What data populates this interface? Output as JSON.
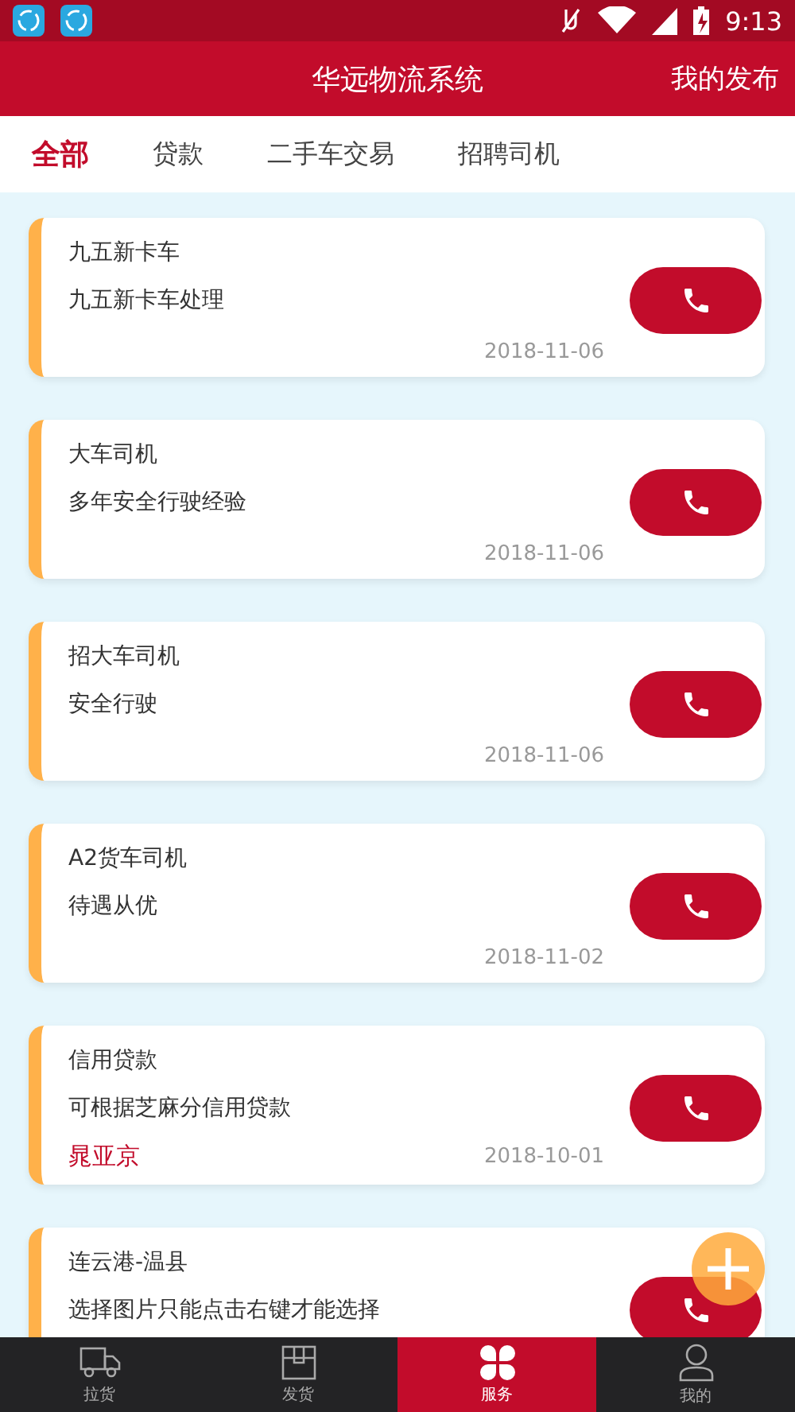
{
  "status_bar": {
    "time": "9:13"
  },
  "header": {
    "title": "华远物流系统",
    "action": "我的发布"
  },
  "tabs": [
    {
      "label": "全部",
      "selected": true
    },
    {
      "label": "贷款",
      "selected": false
    },
    {
      "label": "二手车交易",
      "selected": false
    },
    {
      "label": "招聘司机",
      "selected": false
    }
  ],
  "posts": [
    {
      "title": "九五新卡车",
      "description": "九五新卡车处理",
      "date": "2018-11-06"
    },
    {
      "title": "大车司机",
      "description": "多年安全行驶经验",
      "date": "2018-11-06"
    },
    {
      "title": "招大车司机",
      "description": "安全行驶",
      "date": "2018-11-06"
    },
    {
      "title": "A2货车司机",
      "description": "待遇从优",
      "date": "2018-11-02"
    },
    {
      "title": "信用贷款",
      "description": "可根据芝麻分信用贷款",
      "contact": "晁亚京",
      "date": "2018-10-01"
    },
    {
      "title": "连云港-温县",
      "description": "选择图片只能点击右键才能选择"
    }
  ],
  "bottom_nav": [
    {
      "label": "拉货",
      "kind": "truck",
      "selected": false
    },
    {
      "label": "发货",
      "kind": "box",
      "selected": false
    },
    {
      "label": "服务",
      "kind": "clover",
      "selected": true
    },
    {
      "label": "我的",
      "kind": "person",
      "selected": false
    }
  ]
}
